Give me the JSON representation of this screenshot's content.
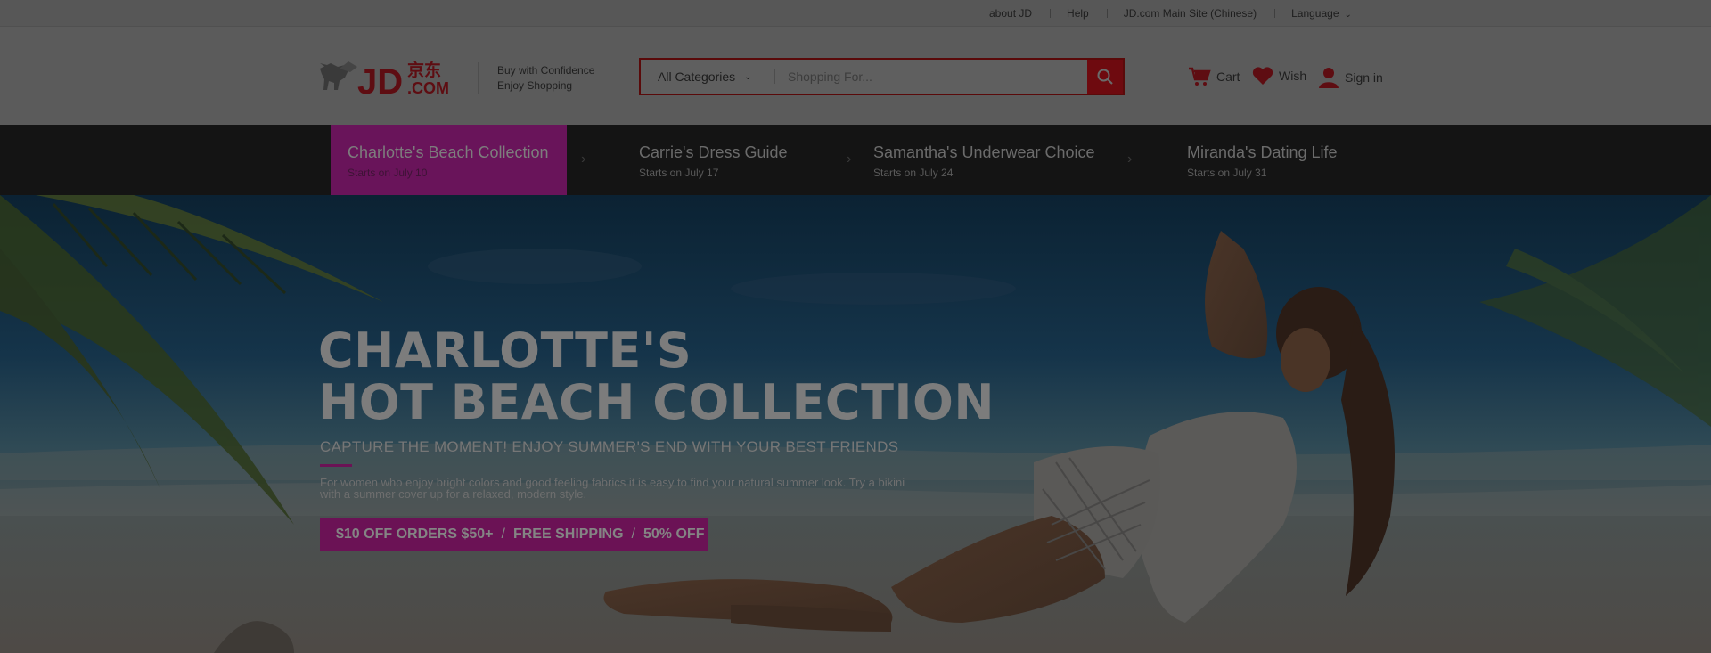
{
  "topbar": {
    "links": [
      "about JD",
      "Help",
      "JD.com Main Site (Chinese)",
      "Language"
    ]
  },
  "header": {
    "logo_text": "JD.COM",
    "tagline_1": "Buy with Confidence",
    "tagline_2": "Enjoy Shopping",
    "search": {
      "category": "All Categories",
      "placeholder": "Shopping For..."
    },
    "cart_label": "Cart",
    "wish_label": "Wish",
    "signin_label": "Sign in"
  },
  "catnav": {
    "items": [
      {
        "title": "Charlotte's Beach Collection",
        "subtitle": "Starts on July 10"
      },
      {
        "title": "Carrie's Dress Guide",
        "subtitle": "Starts on July 17"
      },
      {
        "title": "Samantha's Underwear Choice",
        "subtitle": "Starts on July 24"
      },
      {
        "title": "Miranda's Dating Life",
        "subtitle": "Starts on July 31"
      }
    ]
  },
  "hero": {
    "headline_1": "CHARLOTTE'S",
    "headline_2": "HOT BEACH COLLECTION",
    "subhead": "CAPTURE THE MOMENT! ENJOY SUMMER'S END WITH YOUR BEST FRIENDS",
    "description": "For women who enjoy bright colors and good feeling fabrics it is easy to find your natural summer look. Try a bikini with a summer cover up for a relaxed, modern style.",
    "promo_1": "$10 OFF ORDERS $50+",
    "promo_2": "FREE SHIPPING",
    "promo_3": "50% OFF"
  },
  "colors": {
    "brand_red": "#6e0a0f",
    "accent_magenta": "#69145a",
    "nav_bg": "#141414"
  }
}
